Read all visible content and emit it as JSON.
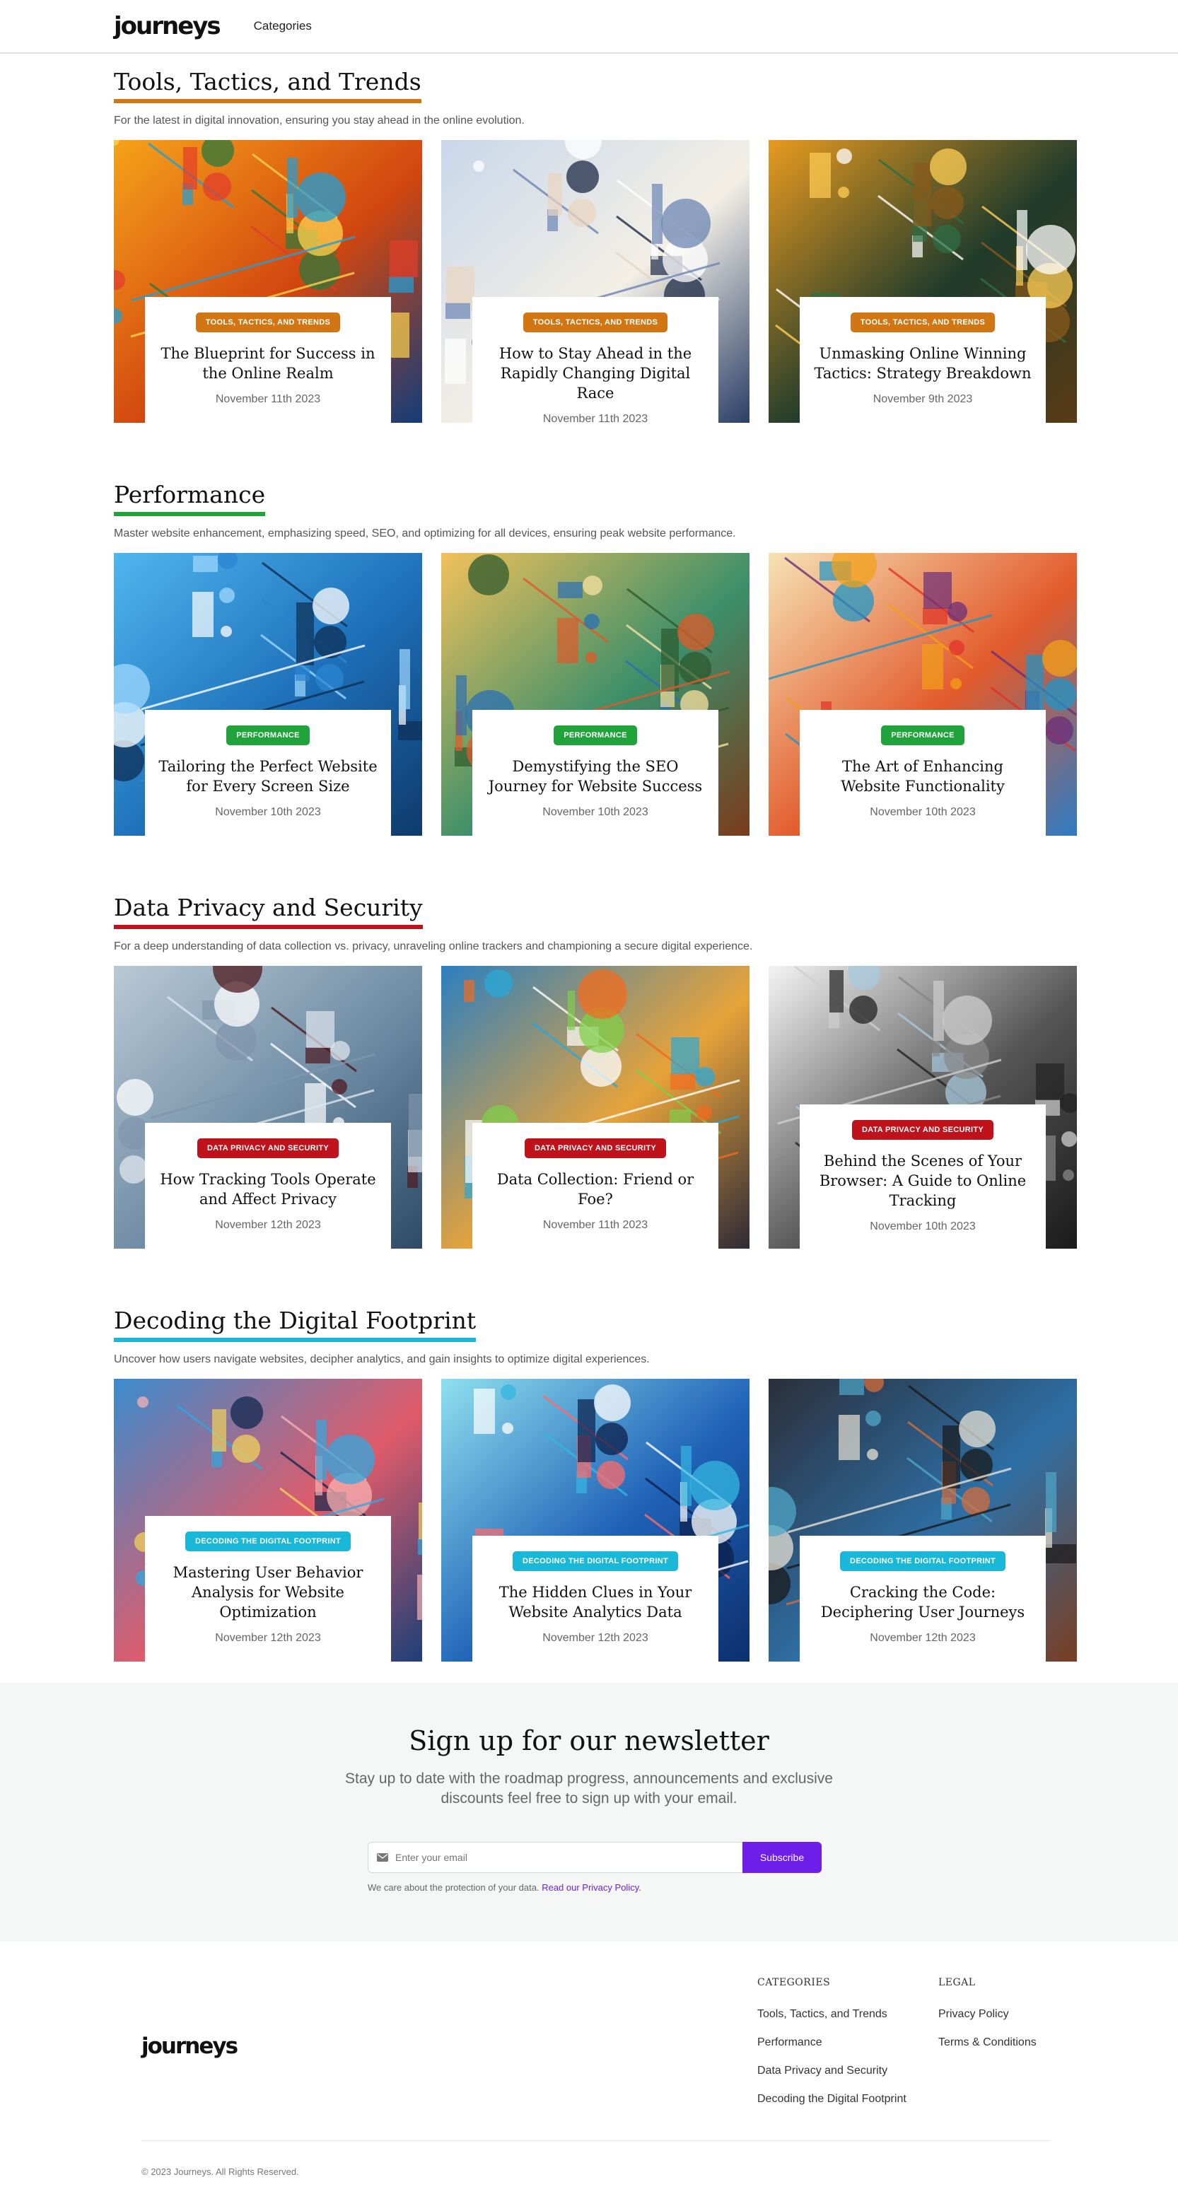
{
  "header": {
    "logo": "journeys",
    "nav_categories": "Categories"
  },
  "sections": [
    {
      "title": "Tools, Tactics, and Trends",
      "description": "For the latest in digital innovation, ensuring you stay ahead in the online evolution.",
      "accent": "#d27614",
      "cards": [
        {
          "badge": "TOOLS, TACTICS, AND TRENDS",
          "title": "The Blueprint for Success in the Online Realm",
          "date": "November 11th 2023"
        },
        {
          "badge": "TOOLS, TACTICS, AND TRENDS",
          "title": "How to Stay Ahead in the Rapidly Changing Digital Race",
          "date": "November 11th 2023"
        },
        {
          "badge": "TOOLS, TACTICS, AND TRENDS",
          "title": "Unmasking Online Winning Tactics: Strategy Breakdown",
          "date": "November 9th 2023"
        }
      ]
    },
    {
      "title": "Performance",
      "description": "Master website enhancement, emphasizing speed, SEO, and optimizing for all devices, ensuring peak website performance.",
      "accent": "#21a33b",
      "cards": [
        {
          "badge": "PERFORMANCE",
          "title": "Tailoring the Perfect Website for Every Screen Size",
          "date": "November 10th 2023"
        },
        {
          "badge": "PERFORMANCE",
          "title": "Demystifying the SEO Journey for Website Success",
          "date": "November 10th 2023"
        },
        {
          "badge": "PERFORMANCE",
          "title": "The Art of Enhancing Website Functionality",
          "date": "November 10th 2023"
        }
      ]
    },
    {
      "title": "Data Privacy and Security",
      "description": "For a deep understanding of data collection vs. privacy, unraveling online trackers and championing a secure digital experience.",
      "accent": "#c0121a",
      "cards": [
        {
          "badge": "DATA PRIVACY AND SECURITY",
          "title": "How Tracking Tools Operate and Affect Privacy",
          "date": "November 12th 2023"
        },
        {
          "badge": "DATA PRIVACY AND SECURITY",
          "title": "Data Collection: Friend or Foe?",
          "date": "November 11th 2023"
        },
        {
          "badge": "DATA PRIVACY AND SECURITY",
          "title": "Behind the Scenes of Your Browser: A Guide to Online Tracking",
          "date": "November 10th 2023"
        }
      ]
    },
    {
      "title": "Decoding the Digital Footprint",
      "description": "Uncover how users navigate websites, decipher analytics, and gain insights to optimize digital experiences.",
      "accent": "#1ab8d8",
      "cards": [
        {
          "badge": "DECODING THE DIGITAL FOOTPRINT",
          "title": "Mastering User Behavior Analysis for Website Optimization",
          "date": "November 12th 2023"
        },
        {
          "badge": "DECODING THE DIGITAL FOOTPRINT",
          "title": "The Hidden Clues in Your Website Analytics Data",
          "date": "November 12th 2023"
        },
        {
          "badge": "DECODING THE DIGITAL FOOTPRINT",
          "title": "Cracking the Code: Deciphering User Journeys",
          "date": "November 12th 2023"
        }
      ]
    }
  ],
  "newsletter": {
    "title": "Sign up for our newsletter",
    "subtitle": "Stay up to date with the roadmap progress, announcements and exclusive discounts feel free to sign up with your email.",
    "placeholder": "Enter your email",
    "button": "Subscribe",
    "note": "We care about the protection of your data.",
    "note_link": "Read our Privacy Policy."
  },
  "footer": {
    "logo": "journeys",
    "categories_heading": "CATEGORIES",
    "categories": [
      "Tools, Tactics, and Trends",
      "Performance",
      "Data Privacy and Security",
      "Decoding the Digital Footprint"
    ],
    "legal_heading": "LEGAL",
    "legal": [
      "Privacy Policy",
      "Terms & Conditions"
    ],
    "copyright": "© 2023 Journeys. All Rights Reserved."
  }
}
